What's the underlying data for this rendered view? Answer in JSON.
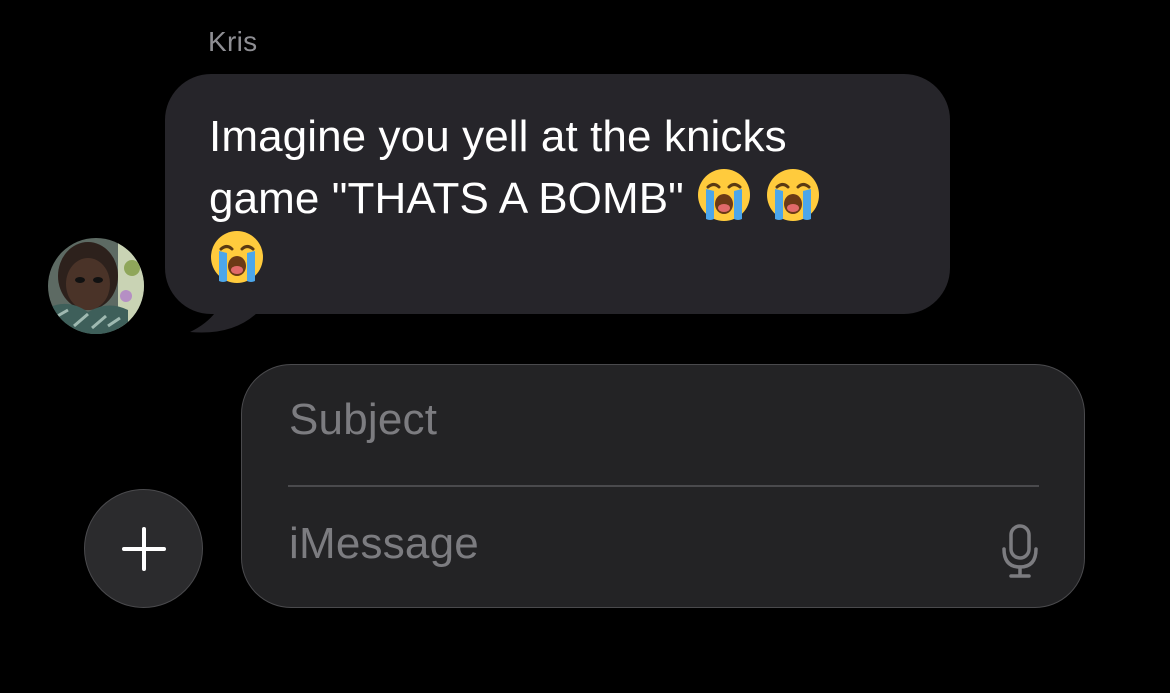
{
  "conversation": {
    "sender_name": "Kris",
    "avatar_icon": "contact-photo-avatar",
    "message": {
      "line1": "Imagine you yell at the knicks",
      "line2": "game \"THATS A BOMB\" ",
      "emoji_icon": "loudly-crying-face-emoji",
      "emoji_count": 3
    }
  },
  "composer": {
    "add_button_icon": "plus-icon",
    "subject_placeholder": "Subject",
    "message_placeholder": "iMessage",
    "mic_icon": "microphone-icon"
  },
  "colors": {
    "background": "#000000",
    "bubble": "#26252a",
    "sender_name": "#8e8e93",
    "placeholder": "#7c7c80",
    "compose_background": "#232325",
    "border": "#4a4a4d"
  }
}
